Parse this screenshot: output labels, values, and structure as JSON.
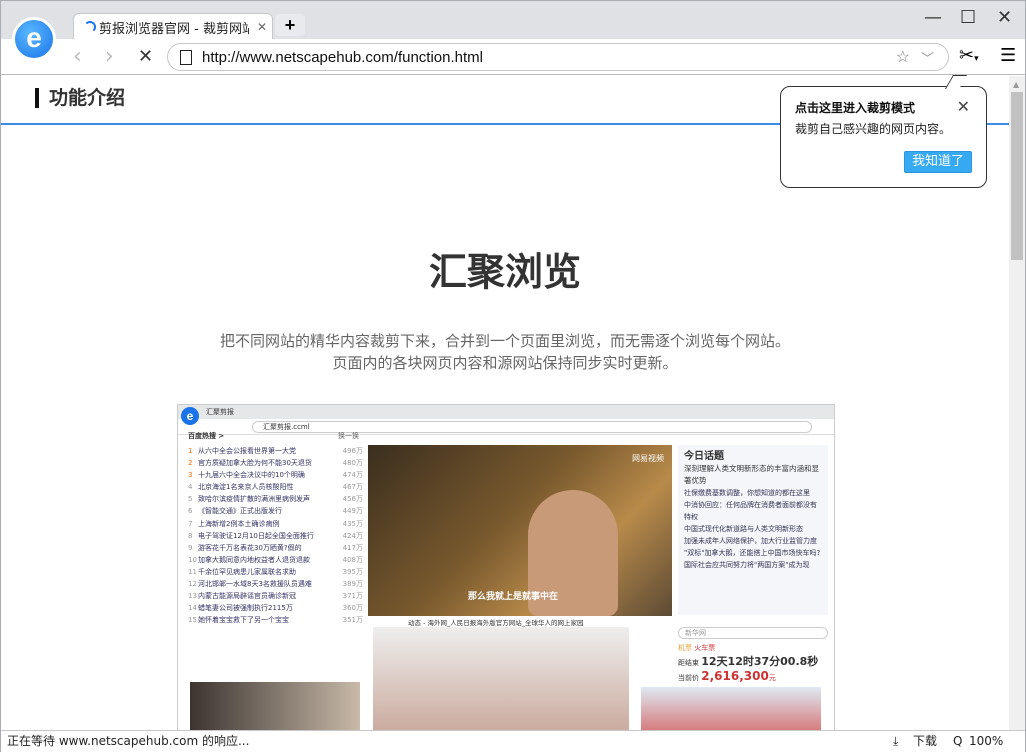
{
  "browser": {
    "tab_title": "剪报浏览器官网 - 裁剪网站",
    "new_tab": "+",
    "url": "http://www.netscapehub.com/function.html"
  },
  "page": {
    "section_title": "功能介绍",
    "heading": "汇聚浏览",
    "description": "把不同网站的精华内容裁剪下来，合并到一个页面里浏览，而无需逐个浏览每个网站。页面内的各块网页内容和源网站保持同步实时更新。"
  },
  "preview": {
    "tab": "汇聚剪报",
    "url": "汇聚剪报.ccml",
    "hot_title": "百度热搜 >",
    "refresh": "换一换",
    "hot": [
      [
        "1",
        "从六中全会公报看世界第一大党",
        "496万"
      ],
      [
        "2",
        "官方质疑加拿大脸为何不能30天退货",
        "480万"
      ],
      [
        "3",
        "十九届六中全会决议中的10个明确",
        "474万"
      ],
      [
        "4",
        "北京海淀1名来京人员核酸阳性",
        "467万"
      ],
      [
        "5",
        "致哈尔滨疫情扩散的满洲里病例发声",
        "456万"
      ],
      [
        "6",
        "《智能交通》正式出版发行",
        "449万"
      ],
      [
        "7",
        "上海新增2例本土确诊病例",
        "435万"
      ],
      [
        "8",
        "电子驾驶证12月10日起全国全面推行",
        "424万"
      ],
      [
        "9",
        "游客花千万名表花30万晒黄?假的",
        "417万"
      ],
      [
        "10",
        "加拿大鹅同意内地权益者人退货退款",
        "408万"
      ],
      [
        "11",
        "千余位罕见病患儿家属联名求助",
        "395万"
      ],
      [
        "12",
        "河北邯郸一水域8天3名救援队员遇难",
        "389万"
      ],
      [
        "13",
        "内蒙古能源局辟谣官员确诊新冠",
        "371万"
      ],
      [
        "14",
        "蜡笔妻公司被强制执行2115万",
        "360万"
      ],
      [
        "15",
        "她怀着宝宝救下了另一个宝宝",
        "351万"
      ]
    ],
    "video_caption": "那么我就上是就事中在",
    "video_brand": "网易视频",
    "news_brand": "今日话题",
    "news_headline": "深刻理解人类文明新形态的丰富内涵和显著优势",
    "news": [
      "社保缴费基数调整，你想知道的都在这里",
      "中消协回应：任何品牌在消费者面前都没有特权",
      "中国式现代化新道路与人类文明新形态",
      "加强未成年人网络保护，加大行业监管力度",
      "\"双标\"加拿大鹅，还能搭上中国市场快车吗?",
      "国际社会应共同努力将\"两国方案\"成为现"
    ],
    "search_placeholder": "新华网",
    "feed_caption": "动态 - 海外网_人民日报海外版官方网站_全球华人的网上家园",
    "airport": "机票",
    "train": "火车票",
    "countdown_label": "距结束",
    "countdown": "12天12时37分00.8秒",
    "price_label": "当前价",
    "price": "2,616,300",
    "price_unit": "元"
  },
  "popup": {
    "title": "点击这里进入裁剪模式",
    "message": "裁剪自己感兴趣的网页内容。",
    "ok": "我知道了"
  },
  "status": {
    "text": "正在等待 www.netscapehub.com 的响应...",
    "download": "下载",
    "zoom": "100%"
  }
}
